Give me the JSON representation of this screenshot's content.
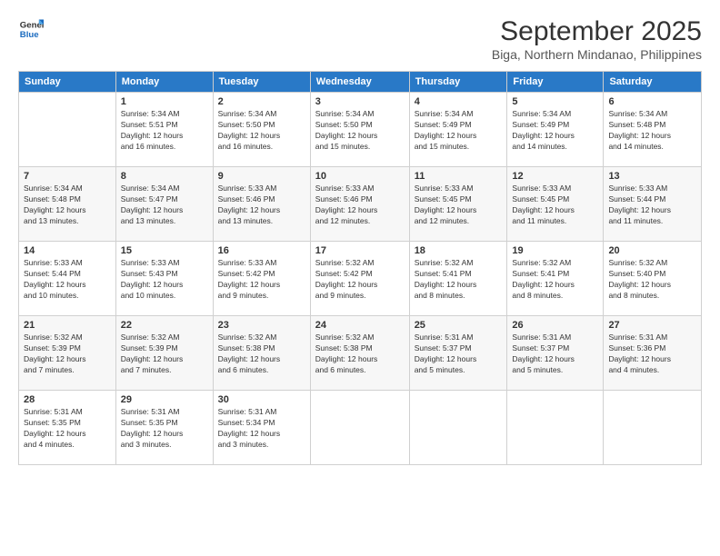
{
  "logo": {
    "line1": "General",
    "line2": "Blue"
  },
  "title": "September 2025",
  "subtitle": "Biga, Northern Mindanao, Philippines",
  "days_header": [
    "Sunday",
    "Monday",
    "Tuesday",
    "Wednesday",
    "Thursday",
    "Friday",
    "Saturday"
  ],
  "weeks": [
    [
      {
        "day": "",
        "info": ""
      },
      {
        "day": "1",
        "info": "Sunrise: 5:34 AM\nSunset: 5:51 PM\nDaylight: 12 hours\nand 16 minutes."
      },
      {
        "day": "2",
        "info": "Sunrise: 5:34 AM\nSunset: 5:50 PM\nDaylight: 12 hours\nand 16 minutes."
      },
      {
        "day": "3",
        "info": "Sunrise: 5:34 AM\nSunset: 5:50 PM\nDaylight: 12 hours\nand 15 minutes."
      },
      {
        "day": "4",
        "info": "Sunrise: 5:34 AM\nSunset: 5:49 PM\nDaylight: 12 hours\nand 15 minutes."
      },
      {
        "day": "5",
        "info": "Sunrise: 5:34 AM\nSunset: 5:49 PM\nDaylight: 12 hours\nand 14 minutes."
      },
      {
        "day": "6",
        "info": "Sunrise: 5:34 AM\nSunset: 5:48 PM\nDaylight: 12 hours\nand 14 minutes."
      }
    ],
    [
      {
        "day": "7",
        "info": "Sunrise: 5:34 AM\nSunset: 5:48 PM\nDaylight: 12 hours\nand 13 minutes."
      },
      {
        "day": "8",
        "info": "Sunrise: 5:34 AM\nSunset: 5:47 PM\nDaylight: 12 hours\nand 13 minutes."
      },
      {
        "day": "9",
        "info": "Sunrise: 5:33 AM\nSunset: 5:46 PM\nDaylight: 12 hours\nand 13 minutes."
      },
      {
        "day": "10",
        "info": "Sunrise: 5:33 AM\nSunset: 5:46 PM\nDaylight: 12 hours\nand 12 minutes."
      },
      {
        "day": "11",
        "info": "Sunrise: 5:33 AM\nSunset: 5:45 PM\nDaylight: 12 hours\nand 12 minutes."
      },
      {
        "day": "12",
        "info": "Sunrise: 5:33 AM\nSunset: 5:45 PM\nDaylight: 12 hours\nand 11 minutes."
      },
      {
        "day": "13",
        "info": "Sunrise: 5:33 AM\nSunset: 5:44 PM\nDaylight: 12 hours\nand 11 minutes."
      }
    ],
    [
      {
        "day": "14",
        "info": "Sunrise: 5:33 AM\nSunset: 5:44 PM\nDaylight: 12 hours\nand 10 minutes."
      },
      {
        "day": "15",
        "info": "Sunrise: 5:33 AM\nSunset: 5:43 PM\nDaylight: 12 hours\nand 10 minutes."
      },
      {
        "day": "16",
        "info": "Sunrise: 5:33 AM\nSunset: 5:42 PM\nDaylight: 12 hours\nand 9 minutes."
      },
      {
        "day": "17",
        "info": "Sunrise: 5:32 AM\nSunset: 5:42 PM\nDaylight: 12 hours\nand 9 minutes."
      },
      {
        "day": "18",
        "info": "Sunrise: 5:32 AM\nSunset: 5:41 PM\nDaylight: 12 hours\nand 8 minutes."
      },
      {
        "day": "19",
        "info": "Sunrise: 5:32 AM\nSunset: 5:41 PM\nDaylight: 12 hours\nand 8 minutes."
      },
      {
        "day": "20",
        "info": "Sunrise: 5:32 AM\nSunset: 5:40 PM\nDaylight: 12 hours\nand 8 minutes."
      }
    ],
    [
      {
        "day": "21",
        "info": "Sunrise: 5:32 AM\nSunset: 5:39 PM\nDaylight: 12 hours\nand 7 minutes."
      },
      {
        "day": "22",
        "info": "Sunrise: 5:32 AM\nSunset: 5:39 PM\nDaylight: 12 hours\nand 7 minutes."
      },
      {
        "day": "23",
        "info": "Sunrise: 5:32 AM\nSunset: 5:38 PM\nDaylight: 12 hours\nand 6 minutes."
      },
      {
        "day": "24",
        "info": "Sunrise: 5:32 AM\nSunset: 5:38 PM\nDaylight: 12 hours\nand 6 minutes."
      },
      {
        "day": "25",
        "info": "Sunrise: 5:31 AM\nSunset: 5:37 PM\nDaylight: 12 hours\nand 5 minutes."
      },
      {
        "day": "26",
        "info": "Sunrise: 5:31 AM\nSunset: 5:37 PM\nDaylight: 12 hours\nand 5 minutes."
      },
      {
        "day": "27",
        "info": "Sunrise: 5:31 AM\nSunset: 5:36 PM\nDaylight: 12 hours\nand 4 minutes."
      }
    ],
    [
      {
        "day": "28",
        "info": "Sunrise: 5:31 AM\nSunset: 5:35 PM\nDaylight: 12 hours\nand 4 minutes."
      },
      {
        "day": "29",
        "info": "Sunrise: 5:31 AM\nSunset: 5:35 PM\nDaylight: 12 hours\nand 3 minutes."
      },
      {
        "day": "30",
        "info": "Sunrise: 5:31 AM\nSunset: 5:34 PM\nDaylight: 12 hours\nand 3 minutes."
      },
      {
        "day": "",
        "info": ""
      },
      {
        "day": "",
        "info": ""
      },
      {
        "day": "",
        "info": ""
      },
      {
        "day": "",
        "info": ""
      }
    ]
  ]
}
